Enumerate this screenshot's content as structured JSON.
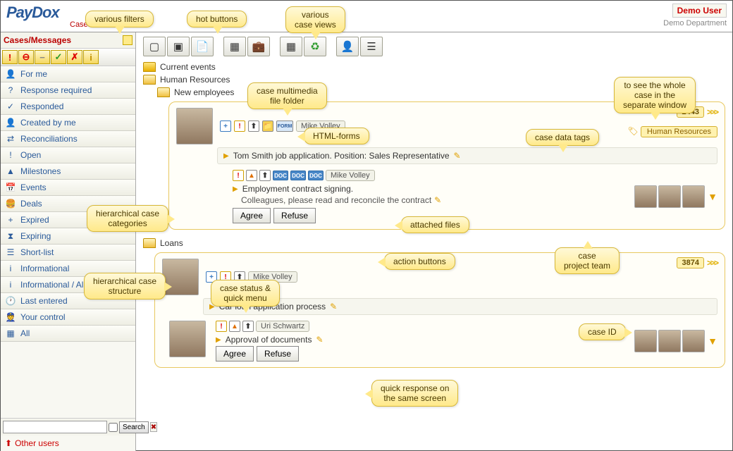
{
  "header": {
    "logo": "PayDox",
    "logo_sub": "Cases",
    "user_name": "Demo User",
    "user_dept": "Demo Department"
  },
  "sidebar": {
    "title": "Cases/Messages",
    "hot_buttons": [
      "!",
      "⊖",
      "−",
      "✓",
      "✗",
      "i"
    ],
    "filters": [
      {
        "icon": "👤",
        "label": "For me"
      },
      {
        "icon": "?",
        "label": "Response required"
      },
      {
        "icon": "✓",
        "label": "Responded"
      },
      {
        "icon": "👤",
        "label": "Created by me"
      },
      {
        "icon": "⇄",
        "label": "Reconciliations"
      },
      {
        "icon": "!",
        "label": "Open"
      },
      {
        "icon": "▲",
        "label": "Milestones"
      },
      {
        "icon": "📅",
        "label": "Events"
      },
      {
        "icon": "🍔",
        "label": "Deals"
      },
      {
        "icon": "+",
        "label": "Expired"
      },
      {
        "icon": "⧗",
        "label": "Expiring"
      },
      {
        "icon": "☰",
        "label": "Short-list"
      },
      {
        "icon": "i",
        "label": "Informational"
      },
      {
        "icon": "i",
        "label": "Informational / All"
      },
      {
        "icon": "🕐",
        "label": "Last entered"
      },
      {
        "icon": "👮",
        "label": "Your control"
      },
      {
        "icon": "▦",
        "label": "All"
      }
    ],
    "search_btn": "Search",
    "other_users": "Other users"
  },
  "tree": {
    "root": "Current events",
    "cat1": "Human Resources",
    "cat1_sub": "New employees",
    "cat2": "Loans"
  },
  "cases": {
    "c1": {
      "id": "2443",
      "author": "Mike Volley",
      "tag": "Human Resources",
      "title": "Tom Smith job application. Position: Sales Representative",
      "sub": {
        "author": "Mike Volley",
        "title": "Employment contract signing.",
        "note": "Colleagues, please read and reconcile the contract",
        "agree": "Agree",
        "refuse": "Refuse"
      }
    },
    "c2": {
      "id": "3874",
      "author": "Mike Volley",
      "title": "Car loan application process",
      "sub": {
        "author": "Uri Schwartz",
        "title": "Approval of documents",
        "agree": "Agree",
        "refuse": "Refuse"
      }
    }
  },
  "callouts": {
    "filters": "various filters",
    "hot": "hot buttons",
    "views": "various\ncase views",
    "hier_cat": "hierarchical case\ncategories",
    "hier_struct": "hierarchical case\nstructure",
    "file_folder": "case multimedia\nfile folder",
    "html_forms": "HTML-forms",
    "data_tags": "case data tags",
    "sep_window": "to see the whole\ncase in the\nseparate window",
    "attached": "attached files",
    "actions": "action buttons",
    "project_team": "case\nproject team",
    "status_menu": "case status &\nquick menu",
    "case_id": "case ID",
    "quick_resp": "quick response on\nthe same screen"
  }
}
